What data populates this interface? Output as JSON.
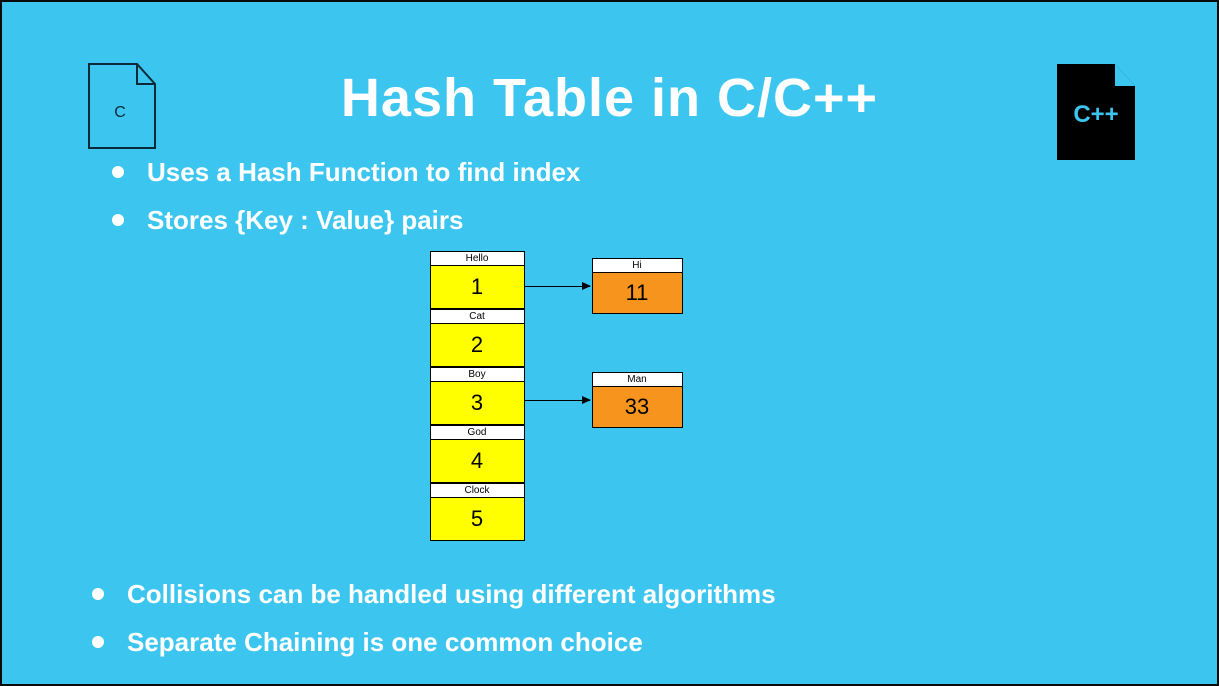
{
  "title": "Hash Table in C/C++",
  "icons": {
    "c_label": "C",
    "cpp_label": "C++"
  },
  "bullets_top": [
    "Uses a Hash Function to find index",
    "Stores {Key : Value} pairs"
  ],
  "bullets_bottom": [
    "Collisions can be handled using different algorithms",
    "Separate Chaining is one common choice"
  ],
  "hash_table": {
    "main": [
      {
        "key": "Hello",
        "value": "1"
      },
      {
        "key": "Cat",
        "value": "2"
      },
      {
        "key": "Boy",
        "value": "3"
      },
      {
        "key": "God",
        "value": "4"
      },
      {
        "key": "Clock",
        "value": "5"
      }
    ],
    "chain0": {
      "key": "Hi",
      "value": "11"
    },
    "chain2": {
      "key": "Man",
      "value": "33"
    }
  }
}
